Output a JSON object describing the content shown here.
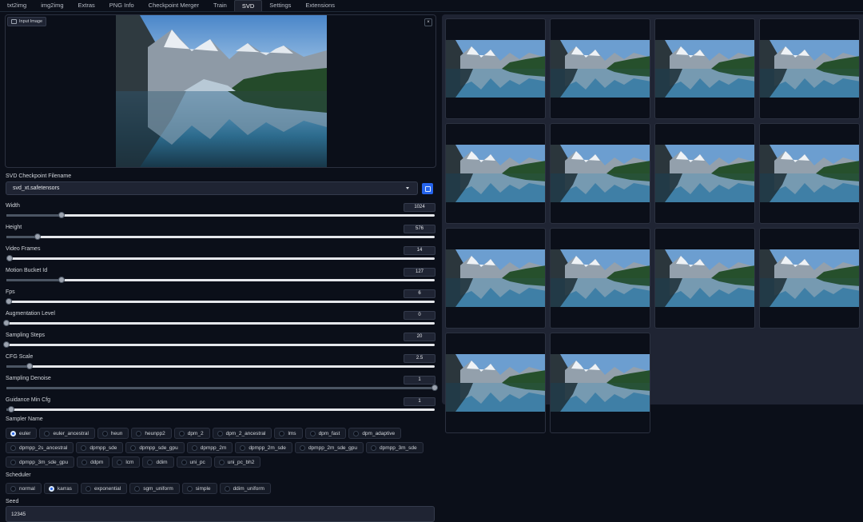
{
  "tabs": [
    "txt2img",
    "img2img",
    "Extras",
    "PNG Info",
    "Checkpoint Merger",
    "Train",
    "SVD",
    "Settings",
    "Extensions"
  ],
  "active_tab": "SVD",
  "input_image": {
    "label": "Input Image",
    "close_icon": "×"
  },
  "checkpoint": {
    "label": "SVD Checkpoint Filename",
    "value": "svd_xt.safetensors"
  },
  "sliders": [
    {
      "label": "Width",
      "value": "1024",
      "fraction": 0.128
    },
    {
      "label": "Height",
      "value": "576",
      "fraction": 0.073
    },
    {
      "label": "Video Frames",
      "value": "14",
      "fraction": 0.008
    },
    {
      "label": "Motion Bucket Id",
      "value": "127",
      "fraction": 0.128
    },
    {
      "label": "Fps",
      "value": "6",
      "fraction": 0.005
    },
    {
      "label": "Augmentation Level",
      "value": "0",
      "fraction": 0.0
    },
    {
      "label": "Sampling Steps",
      "value": "20",
      "fraction": 0.0
    },
    {
      "label": "CFG Scale",
      "value": "2.5",
      "fraction": 0.055
    },
    {
      "label": "Sampling Denoise",
      "value": "1",
      "fraction": 1.0
    },
    {
      "label": "Guidance Min Cfg",
      "value": "1",
      "fraction": 0.012
    }
  ],
  "sampler": {
    "label": "Sampler Name",
    "rows": [
      [
        "euler",
        "euler_ancestral",
        "heun",
        "heunpp2",
        "dpm_2",
        "dpm_2_ancestral",
        "lms",
        "dpm_fast",
        "dpm_adaptive"
      ],
      [
        "dpmpp_2s_ancestral",
        "dpmpp_sde",
        "dpmpp_sde_gpu",
        "dpmpp_2m",
        "dpmpp_2m_sde",
        "dpmpp_2m_sde_gpu",
        "dpmpp_3m_sde"
      ],
      [
        "dpmpp_3m_sde_gpu",
        "ddpm",
        "lcm",
        "ddim",
        "uni_pc",
        "uni_pc_bh2"
      ]
    ],
    "selected": "euler"
  },
  "scheduler": {
    "label": "Scheduler",
    "options": [
      "normal",
      "karras",
      "exponential",
      "sgm_uniform",
      "simple",
      "ddim_uniform"
    ],
    "selected": "karras"
  },
  "seed": {
    "label": "Seed",
    "value": "12345"
  },
  "gallery": {
    "frame_count": 14
  },
  "colors": {
    "accent": "#2563eb",
    "background": "#0b0f19",
    "panel": "#1f2433"
  }
}
